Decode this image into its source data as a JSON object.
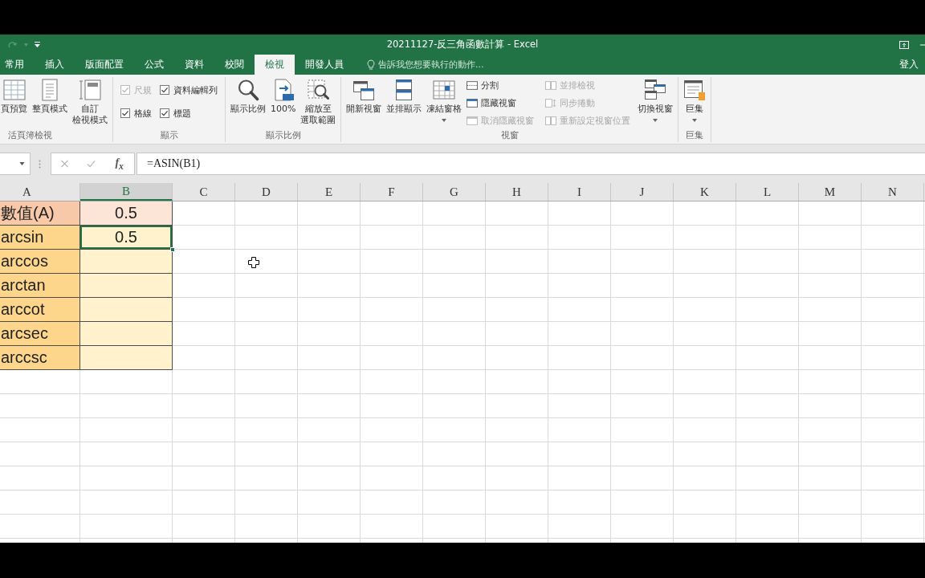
{
  "title_bar": {
    "title": "20211127-反三角函數計算 - Excel"
  },
  "ribbon_tabs": [
    {
      "label": "常用",
      "selected": false
    },
    {
      "label": "插入",
      "selected": false
    },
    {
      "label": "版面配置",
      "selected": false
    },
    {
      "label": "公式",
      "selected": false
    },
    {
      "label": "資料",
      "selected": false
    },
    {
      "label": "校閱",
      "selected": false
    },
    {
      "label": "檢視",
      "selected": true
    },
    {
      "label": "開發人員",
      "selected": false
    }
  ],
  "tell_me": {
    "placeholder": "告訴我您想要執行的動作..."
  },
  "sign_in": "登入",
  "ribbon_groups": [
    {
      "label": "活頁簿檢視",
      "items": [
        {
          "kind": "large",
          "lines": [
            "頁預覽"
          ],
          "dropdown": false
        },
        {
          "kind": "large",
          "lines": [
            "整頁模式"
          ],
          "dropdown": false
        },
        {
          "kind": "large",
          "lines": [
            "自訂",
            "檢視模式"
          ],
          "dropdown": false
        }
      ]
    },
    {
      "label": "顯示",
      "items": [
        {
          "kind": "checkbox",
          "label": "尺規",
          "checked": true,
          "disabled": true
        },
        {
          "kind": "checkbox",
          "label": "格線",
          "checked": true,
          "disabled": false
        },
        {
          "kind": "checkbox",
          "label": "資料編輯列",
          "checked": true,
          "disabled": false
        },
        {
          "kind": "checkbox",
          "label": "標題",
          "checked": true,
          "disabled": false
        }
      ]
    },
    {
      "label": "顯示比例",
      "items": [
        {
          "kind": "large",
          "lines": [
            "顯示比例"
          ],
          "dropdown": false
        },
        {
          "kind": "large",
          "lines": [
            "100%"
          ],
          "dropdown": false
        },
        {
          "kind": "large",
          "lines": [
            "縮放至",
            "選取範圍"
          ],
          "dropdown": false
        }
      ]
    },
    {
      "label": "視窗",
      "items": [
        {
          "kind": "large",
          "lines": [
            "開新視窗"
          ],
          "dropdown": false
        },
        {
          "kind": "large",
          "lines": [
            "並排顯示"
          ],
          "dropdown": false
        },
        {
          "kind": "large",
          "lines": [
            "凍結窗格"
          ],
          "dropdown": true
        },
        {
          "kind": "small",
          "label": "分割",
          "disabled": false
        },
        {
          "kind": "small",
          "label": "隱藏視窗",
          "disabled": false
        },
        {
          "kind": "small",
          "label": "取消隱藏視窗",
          "disabled": true
        },
        {
          "kind": "small",
          "label": "並排檢視",
          "disabled": true
        },
        {
          "kind": "small",
          "label": "同步捲動",
          "disabled": true
        },
        {
          "kind": "small",
          "label": "重新設定視窗位置",
          "disabled": true
        },
        {
          "kind": "large",
          "lines": [
            "切換視窗"
          ],
          "dropdown": true
        }
      ]
    },
    {
      "label": "巨集",
      "items": [
        {
          "kind": "large",
          "lines": [
            "巨集"
          ],
          "dropdown": true
        }
      ]
    }
  ],
  "formula_bar": {
    "function_label": "f$_{x}$",
    "formula": "=ASIN(B1)"
  },
  "sheet": {
    "columns": [
      {
        "label": "A",
        "selected": false
      },
      {
        "label": "B",
        "selected": true
      },
      {
        "label": "C",
        "selected": false
      },
      {
        "label": "D",
        "selected": false
      },
      {
        "label": "E",
        "selected": false
      },
      {
        "label": "F",
        "selected": false
      },
      {
        "label": "G",
        "selected": false
      },
      {
        "label": "H",
        "selected": false
      },
      {
        "label": "I",
        "selected": false
      },
      {
        "label": "J",
        "selected": false
      },
      {
        "label": "K",
        "selected": false
      },
      {
        "label": "L",
        "selected": false
      },
      {
        "label": "M",
        "selected": false
      },
      {
        "label": "N",
        "selected": false
      }
    ],
    "rows": [
      {
        "cells": [
          {
            "text": "數值(A)",
            "color": "#f8c9a8",
            "selected": false
          },
          {
            "text": "0.5",
            "color": "#fce4d6",
            "selected": false
          }
        ]
      },
      {
        "cells": [
          {
            "text": "arcsin",
            "color": "#fdd68b",
            "selected": false
          },
          {
            "text": "0.5",
            "color": "#fff2cc",
            "selected": true
          }
        ]
      },
      {
        "cells": [
          {
            "text": "arccos",
            "color": "#fdd68b",
            "selected": false
          },
          {
            "color": "#fff2cc",
            "selected": false
          }
        ]
      },
      {
        "cells": [
          {
            "text": "arctan",
            "color": "#fdd68b",
            "selected": false
          },
          {
            "color": "#fff2cc",
            "selected": false
          }
        ]
      },
      {
        "cells": [
          {
            "text": "arccot",
            "color": "#fdd68b",
            "selected": false
          },
          {
            "color": "#fff2cc",
            "selected": false
          }
        ]
      },
      {
        "cells": [
          {
            "text": "arcsec",
            "color": "#fdd68b",
            "selected": false
          },
          {
            "color": "#fff2cc",
            "selected": false
          }
        ]
      },
      {
        "cells": [
          {
            "text": "arccsc",
            "color": "#fdd68b",
            "selected": false
          },
          {
            "color": "#fff2cc",
            "selected": false
          }
        ]
      }
    ]
  }
}
